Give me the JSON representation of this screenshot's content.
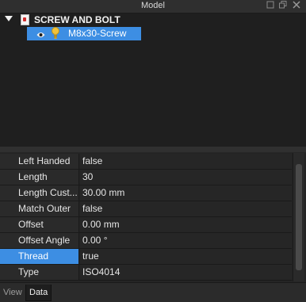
{
  "window": {
    "title": "Model",
    "controls": [
      "restore-icon",
      "float-icon",
      "close-icon"
    ]
  },
  "tree": {
    "root_label": "SCREW AND BOLT",
    "child_label": "M8x30-Screw"
  },
  "properties": [
    {
      "name": "Left Handed",
      "value": "false"
    },
    {
      "name": "Length",
      "value": "30"
    },
    {
      "name": "Length Cust...",
      "value": "30.00 mm"
    },
    {
      "name": "Match Outer",
      "value": "false"
    },
    {
      "name": "Offset",
      "value": "0.00 mm"
    },
    {
      "name": "Offset Angle",
      "value": "0.00 °"
    },
    {
      "name": "Thread",
      "value": "true"
    },
    {
      "name": "Type",
      "value": "ISO4014"
    }
  ],
  "selected_property": "Thread",
  "tabs": [
    {
      "label": "View"
    },
    {
      "label": "Data"
    }
  ],
  "active_tab": "Data",
  "colors": {
    "selection": "#3d8ee3",
    "background": "#262626"
  }
}
